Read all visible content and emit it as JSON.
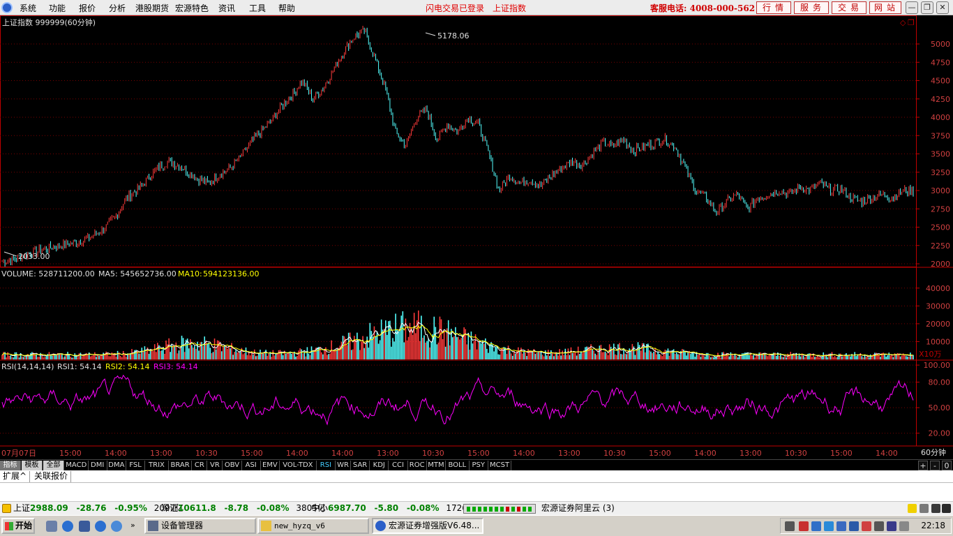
{
  "menu": {
    "items": [
      "系统",
      "功能",
      "报价",
      "分析",
      "港股期货",
      "宏源特色",
      "资讯",
      "工具",
      "帮助"
    ],
    "status1": "闪电交易已登录",
    "status2": "上证指数",
    "hotline": "客服电话: 4008-000-562",
    "quick_buttons": [
      "行情",
      "服务",
      "交易",
      "网站"
    ],
    "window_buttons": [
      "minimize",
      "restore",
      "close"
    ]
  },
  "main_chart": {
    "title": "上证指数 999999(60分钟)",
    "high_label": "5178.06",
    "low_label": "2033.00",
    "y_ticks": [
      "5000",
      "4750",
      "4500",
      "4250",
      "4000",
      "3750",
      "3500",
      "3250",
      "3000",
      "2750",
      "2500",
      "2250",
      "2000"
    ],
    "corner_icons": [
      "diamond-icon",
      "restore-icon"
    ]
  },
  "volume_panel": {
    "label": "VOLUME: 528711200.00",
    "ma5": "MA5: 545652736.00",
    "ma10_name": "MA10:",
    "ma10_value": "594123136.00",
    "y_ticks": [
      "40000",
      "30000",
      "20000",
      "10000"
    ],
    "unit": "X10万"
  },
  "rsi_panel": {
    "label": "RSI(14,14,14)",
    "rsi1": "RSI1: 54.14",
    "rsi2_name": "RSI2:",
    "rsi2_value": "54.14",
    "rsi3": "RSI3: 54.14",
    "y_ticks": [
      "100.00",
      "80.00",
      "50.00",
      "20.00"
    ]
  },
  "time_axis": {
    "labels": [
      "07月07日",
      "15:00",
      "14:00",
      "13:00",
      "10:30",
      "15:00",
      "14:00",
      "14:00",
      "13:00",
      "10:30",
      "15:00",
      "14:00",
      "13:00",
      "10:30",
      "15:00",
      "14:00",
      "13:00",
      "10:30",
      "15:00",
      "14:00"
    ],
    "period": "60分钟"
  },
  "indicator_tabs": {
    "groups": [
      "指标",
      "模板",
      "全部"
    ],
    "indicators": [
      "MACD",
      "DMI",
      "DMA",
      "FSL",
      "TRIX",
      "BRAR",
      "CR",
      "VR",
      "OBV",
      "ASI",
      "EMV",
      "VOL-TDX",
      "RSI",
      "WR",
      "SAR",
      "KDJ",
      "CCI",
      "ROC",
      "MTM",
      "BOLL",
      "PSY",
      "MCST"
    ],
    "active": "RSI",
    "controls": [
      "+",
      "-",
      "0"
    ]
  },
  "ext_tabs": [
    "扩展^",
    "关联报价"
  ],
  "index_bar": {
    "items": [
      {
        "name": "上证",
        "price": "2988.09",
        "chg": "-28.76",
        "pct": "-0.95%",
        "amt": "2097亿"
      },
      {
        "name": "深证",
        "price": "10611.8",
        "chg": "-8.78",
        "pct": "-0.08%",
        "amt": "3805亿"
      },
      {
        "name": "中小",
        "price": "6987.70",
        "chg": "-5.80",
        "pct": "-0.08%",
        "amt": "1726亿"
      }
    ],
    "server": "宏源证券阿里云 (3)"
  },
  "taskbar": {
    "start": "开始",
    "tasks": [
      "设备管理器",
      "new_hyzq_v6",
      "宏源证券增强版V6.48..."
    ],
    "clock": "22:18"
  },
  "colors": {
    "up": "#ff3b3b",
    "down": "#54ffff",
    "ma5": "#ffffff",
    "ma10": "#ffff00",
    "rsi": "#ff00ff",
    "grid": "#7a0000",
    "axis": "#c00000"
  },
  "chart_data": {
    "type": "line",
    "title": "上证指数 999999(60分钟)",
    "series": [
      {
        "name": "",
        "values": [
          2033,
          2060,
          2110,
          2150,
          2200,
          2230,
          2260,
          2290,
          2330,
          2400,
          2500,
          2650,
          2900,
          3000,
          3150,
          3300,
          3400,
          3350,
          3250,
          3150,
          3100,
          3220,
          3300,
          3450,
          3650,
          3800,
          3950,
          4150,
          4300,
          4500,
          4250,
          4400,
          4650,
          4900,
          5100,
          5178,
          4800,
          4400,
          3800,
          3600,
          4000,
          4100,
          3700,
          3900,
          3800,
          4000,
          3900,
          3500,
          3000,
          3200,
          3100,
          3150,
          3050,
          3200,
          3300,
          3400,
          3350,
          3500,
          3650,
          3600,
          3700,
          3550,
          3600,
          3650,
          3700,
          3600,
          3300,
          3000,
          2900,
          2700,
          2850,
          2950,
          2750,
          2900,
          2950,
          3000,
          2950,
          3050,
          3000,
          3100,
          3000,
          3020,
          2900,
          2850,
          2900,
          2950,
          2900,
          3000,
          2988
        ]
      }
    ],
    "ylim": [
      2000,
      5200
    ],
    "high": 5178.06,
    "low": 2033.0
  }
}
